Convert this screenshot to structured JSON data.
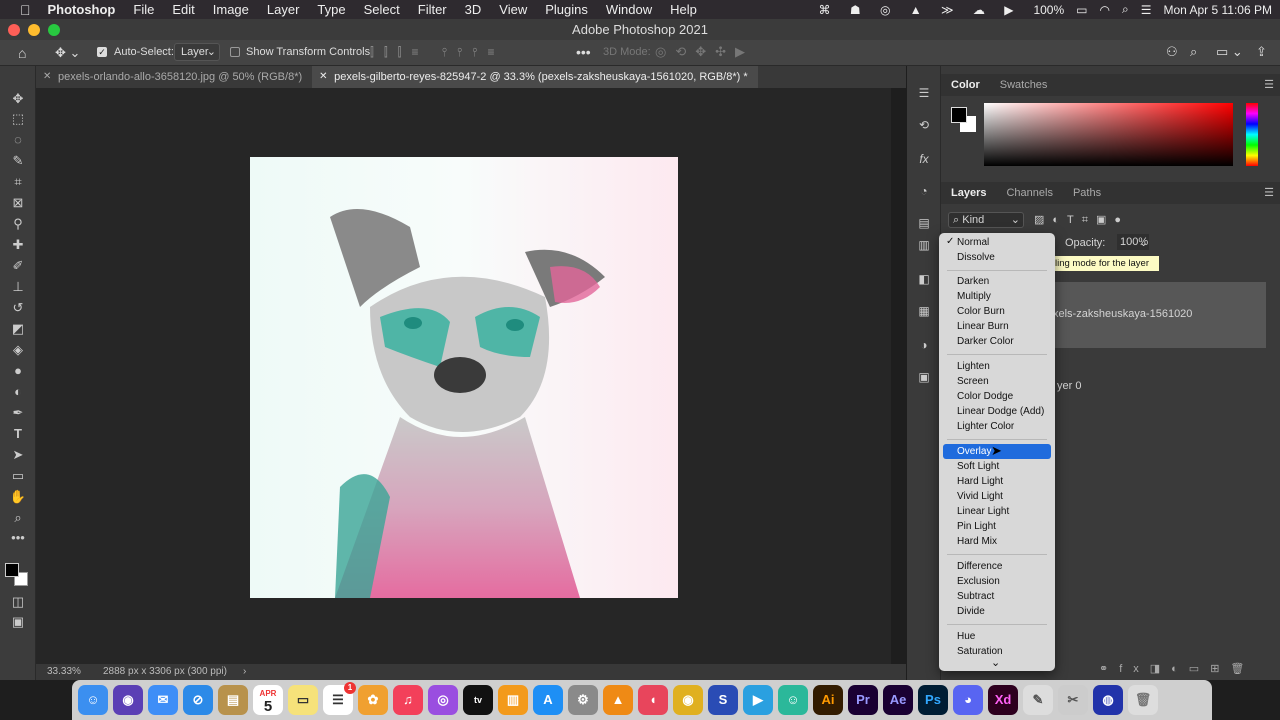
{
  "menubar": {
    "apple_icon": "apple-icon",
    "app_name": "Photoshop",
    "items": [
      "File",
      "Edit",
      "Image",
      "Layer",
      "Type",
      "Select",
      "Filter",
      "3D",
      "View",
      "Plugins",
      "Window",
      "Help"
    ],
    "battery": "100%",
    "datetime": "Mon Apr 5  11:06 PM"
  },
  "window": {
    "title": "Adobe Photoshop 2021"
  },
  "options_bar": {
    "auto_select_label": "Auto-Select:",
    "auto_select_checked": true,
    "auto_select_target": "Layer",
    "show_transform_label": "Show Transform Controls",
    "mode_3d_label": "3D Mode:"
  },
  "document_tabs": [
    {
      "label": "pexels-orlando-allo-3658120.jpg @ 50% (RGB/8*)",
      "active": false
    },
    {
      "label": "pexels-gilberto-reyes-825947-2 @ 33.3% (pexels-zaksheuskaya-1561020, RGB/8*) *",
      "active": true
    }
  ],
  "status_bar": {
    "zoom": "33.33%",
    "doc_info": "2888 px x 3306 px (300 ppi)"
  },
  "color_panel": {
    "tabs": [
      "Color",
      "Swatches"
    ],
    "foreground": "#000000",
    "background": "#ffffff",
    "hue_color": "#ff0000"
  },
  "layers_panel": {
    "tabs": [
      "Layers",
      "Channels",
      "Paths"
    ],
    "filter_kind": "Kind",
    "opacity_label": "Opacity:",
    "opacity_value": "100%",
    "tooltip": "Set the blending mode for the layer",
    "tooltip_visible": "ling mode for the layer",
    "layers": [
      {
        "name_visible": "xels-zaksheuskaya-1561020",
        "selected": true
      },
      {
        "name_visible": "yer 0",
        "selected": false
      }
    ]
  },
  "blend_menu": {
    "checked": "Normal",
    "highlighted": "Overlay",
    "groups": [
      [
        "Normal",
        "Dissolve"
      ],
      [
        "Darken",
        "Multiply",
        "Color Burn",
        "Linear Burn",
        "Darker Color"
      ],
      [
        "Lighten",
        "Screen",
        "Color Dodge",
        "Linear Dodge (Add)",
        "Lighter Color"
      ],
      [
        "Overlay",
        "Soft Light",
        "Hard Light",
        "Vivid Light",
        "Linear Light",
        "Pin Light",
        "Hard Mix"
      ],
      [
        "Difference",
        "Exclusion",
        "Subtract",
        "Divide"
      ],
      [
        "Hue",
        "Saturation"
      ]
    ]
  },
  "dock": {
    "calendar_month": "APR",
    "calendar_day": "5",
    "badge_count": "1"
  },
  "colors": {
    "accent": "#1f6bdd",
    "menubar": "#2e2a2f",
    "panel": "#3a3a3a",
    "canvas_bg": "#262626"
  }
}
